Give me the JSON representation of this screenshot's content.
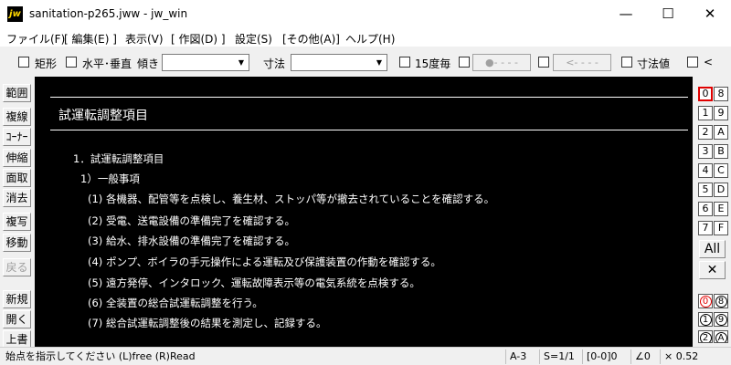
{
  "window": {
    "icon_text": "jw",
    "title": "sanitation-p265.jww - jw_win",
    "minimize": "—",
    "maximize": "☐",
    "close": "✕"
  },
  "menu": [
    "ファイル(F)",
    "[ 編集(E) ]",
    "表示(V)",
    "[ 作図(D) ]",
    "設定(S)",
    "[その他(A)]",
    "ヘルプ(H)"
  ],
  "toolbar": {
    "rect_label": "矩形",
    "hv_label": "水平･垂直",
    "tilt_label": "傾き",
    "tilt_value": "",
    "dim_label": "寸法",
    "dim_value": "",
    "deg15_label": "15度毎",
    "btn1_label": "●- - - -",
    "btn2_label": "<- - - -",
    "dimval_label": "寸法値",
    "last_label": "<"
  },
  "left_tools": [
    "範囲",
    "複線",
    "ｺｰﾅｰ",
    "伸縮",
    "面取",
    "消去",
    "複写",
    "移動",
    "戻る",
    "新規",
    "開く",
    "上書"
  ],
  "canvas": {
    "heading": "試運転調整項目",
    "lines": [
      "1．試運転調整項目",
      "1）一般事項",
      "(1) 各機器、配管等を点検し、養生材、ストッパ等が撤去されていることを確認する。",
      "(2) 受電、送電設備の準備完了を確認する。",
      "(3) 給水、排水設備の準備完了を確認する。",
      "(4) ポンプ、ボイラの手元操作による運転及び保護装置の作動を確認する。",
      "(5) 遠方発停、インタロック、運転故障表示等の電気系統を点検する。",
      "(6) 全装置の総合試運転調整を行う。",
      "(7) 総合試運転調整後の結果を測定し、記録する。"
    ]
  },
  "layers": {
    "left": [
      "0",
      "1",
      "2",
      "3",
      "4",
      "5",
      "6",
      "7"
    ],
    "right": [
      "8",
      "9",
      "A",
      "B",
      "C",
      "D",
      "E",
      "F"
    ],
    "all": "All",
    "x": "✕",
    "group_left": [
      "0",
      "1",
      "2"
    ],
    "group_right": [
      "8",
      "9",
      "A"
    ]
  },
  "status": {
    "message": "始点を指示してください (L)free (R)Read",
    "paper": "A-3",
    "scale": "S=1/1",
    "layer": "[0-0]0",
    "angle": "∠0",
    "zoom": "× 0.52"
  }
}
